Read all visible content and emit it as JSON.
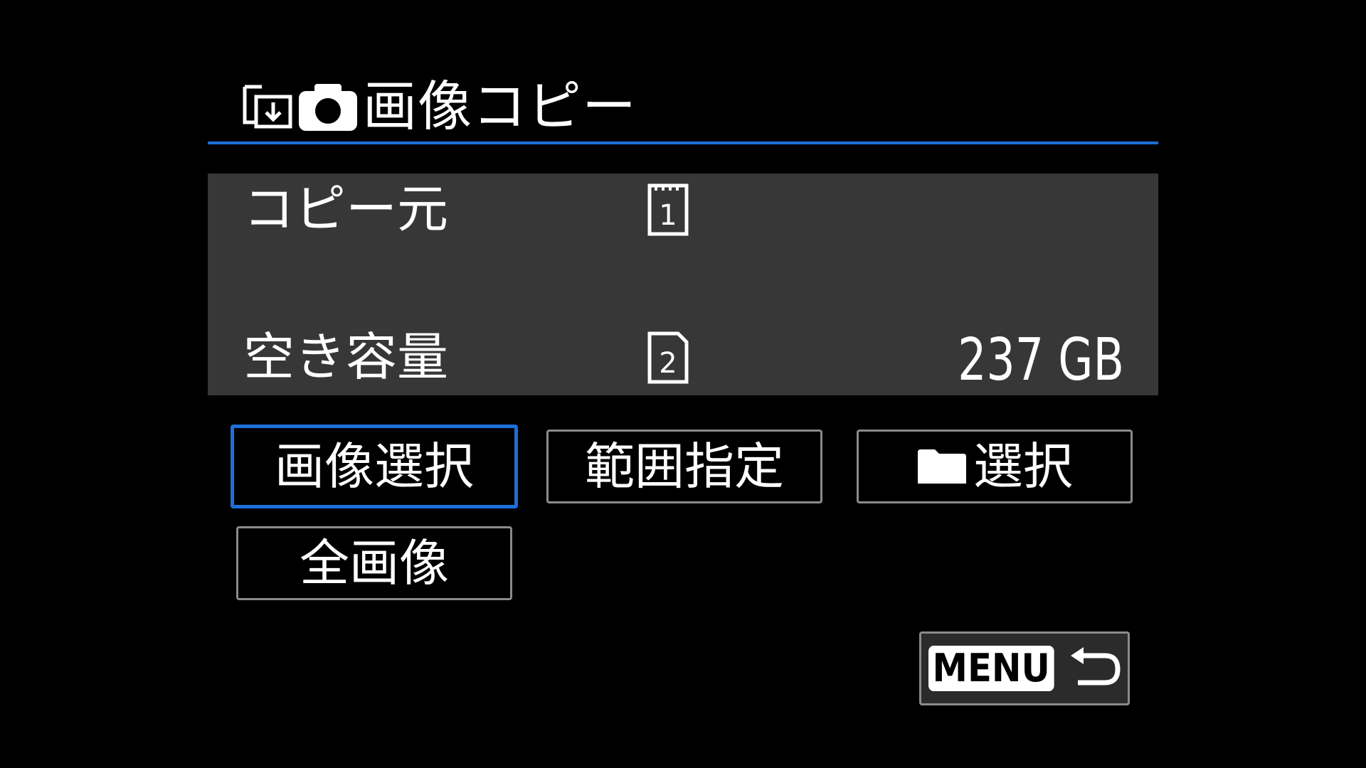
{
  "header": {
    "icon_copy": "copy-to-card-icon",
    "icon_camera": "camera-icon",
    "title": "画像コピー"
  },
  "panel": {
    "source_label": "コピー元",
    "source_card": "1",
    "source_card_icon": "card-slot-1-icon",
    "free_label": "空き容量",
    "free_card": "2",
    "free_card_icon": "card-slot-2-icon",
    "free_value": "237 GB"
  },
  "buttons": {
    "image_select": "画像選択",
    "range": "範囲指定",
    "folder_select": "選択",
    "folder_icon": "folder-icon",
    "all_images": "全画像"
  },
  "menu": {
    "label": "MENU",
    "back_icon": "return-arrow-icon"
  },
  "colors": {
    "accent": "#1e6fd9",
    "panel_bg": "#373737",
    "background": "#000000",
    "border": "#8a8a8a"
  }
}
